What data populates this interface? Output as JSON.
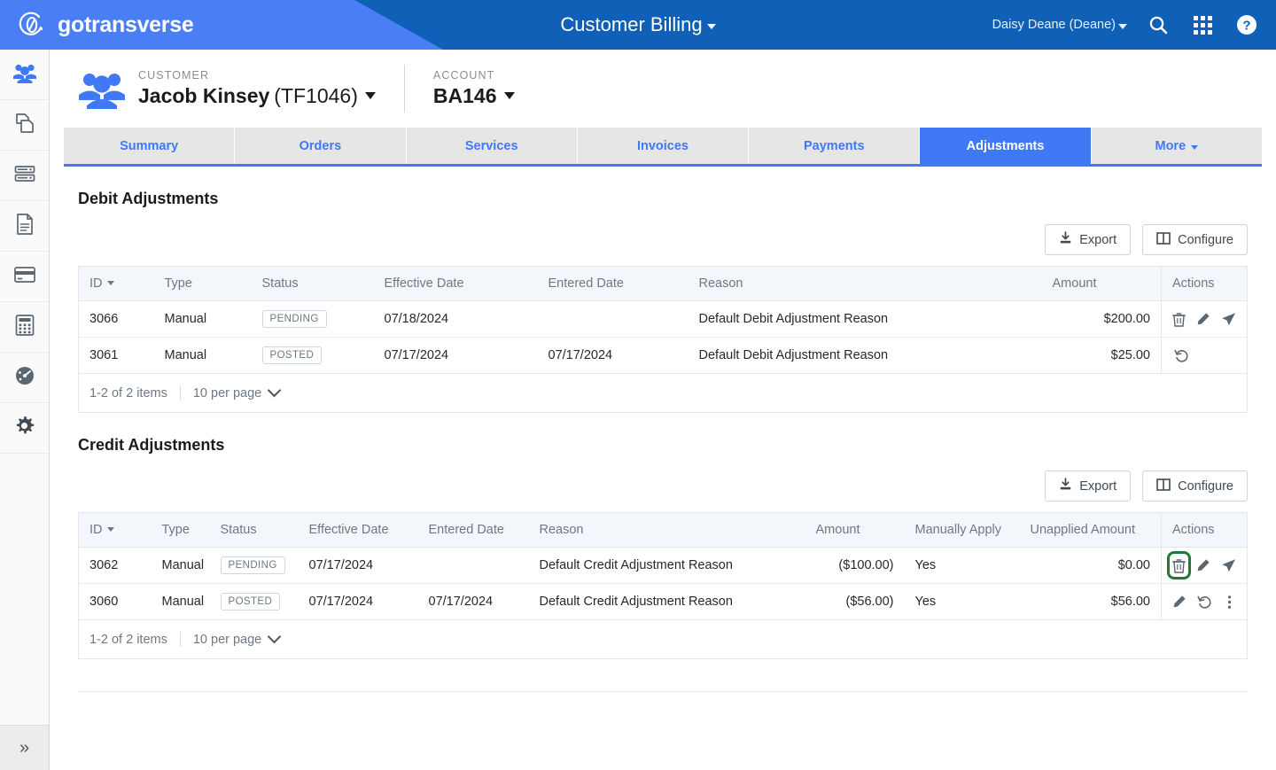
{
  "colors": {
    "brand_blue_light": "#4a7ef5",
    "brand_blue_dark": "#1060b8",
    "tab_active": "#4079f5",
    "highlight_green": "#1e7a36"
  },
  "topbar": {
    "brand_name": "gotransverse",
    "brand_logo_icon": "gotransverse-circle-logo-icon",
    "app_title": "Customer Billing",
    "app_title_caret_icon": "caret-down-icon",
    "user_name": "Daisy Deane (Deane)",
    "user_caret_icon": "caret-down-icon",
    "search_icon": "search-icon",
    "apps_icon": "apps-grid-icon",
    "help_icon": "help-circle-icon"
  },
  "rail": {
    "items": [
      {
        "icon": "customers-people-icon",
        "active": true
      },
      {
        "icon": "copy-documents-icon",
        "active": false
      },
      {
        "icon": "server-database-icon",
        "active": false
      },
      {
        "icon": "document-page-icon",
        "active": false
      },
      {
        "icon": "credit-card-icon",
        "active": false
      },
      {
        "icon": "calculator-icon",
        "active": false
      },
      {
        "icon": "dashboard-gauge-icon",
        "active": false
      },
      {
        "icon": "settings-gear-icon",
        "active": false
      }
    ],
    "expand_icon": "chevron-double-right-icon"
  },
  "context": {
    "customer_icon": "customer-people-icon",
    "customer_label": "CUSTOMER",
    "customer_name": "Jacob Kinsey",
    "customer_id": "(TF1046)",
    "account_label": "ACCOUNT",
    "account_value": "BA146"
  },
  "tabs": [
    {
      "label": "Summary",
      "active": false,
      "has_caret": false
    },
    {
      "label": "Orders",
      "active": false,
      "has_caret": false
    },
    {
      "label": "Services",
      "active": false,
      "has_caret": false
    },
    {
      "label": "Invoices",
      "active": false,
      "has_caret": false
    },
    {
      "label": "Payments",
      "active": false,
      "has_caret": false
    },
    {
      "label": "Adjustments",
      "active": true,
      "has_caret": false
    },
    {
      "label": "More",
      "active": false,
      "has_caret": true
    }
  ],
  "debit": {
    "title": "Debit Adjustments",
    "export_label": "Export",
    "export_icon": "download-icon",
    "configure_label": "Configure",
    "configure_icon": "columns-icon",
    "columns": [
      "ID",
      "Type",
      "Status",
      "Effective Date",
      "Entered Date",
      "Reason",
      "Amount",
      "Actions"
    ],
    "sorted_column": "ID",
    "rows": [
      {
        "id": "3066",
        "type": "Manual",
        "status": "PENDING",
        "effective_date": "07/18/2024",
        "entered_date": "",
        "reason": "Default Debit Adjustment Reason",
        "amount": "$200.00",
        "actions": [
          "delete-icon",
          "edit-icon",
          "send-icon"
        ]
      },
      {
        "id": "3061",
        "type": "Manual",
        "status": "POSTED",
        "effective_date": "07/17/2024",
        "entered_date": "07/17/2024",
        "reason": "Default Debit Adjustment Reason",
        "amount": "$25.00",
        "actions": [
          "revert-icon"
        ]
      }
    ],
    "pager": {
      "items_text": "1-2 of 2 items",
      "per_page_text": "10 per page"
    }
  },
  "credit": {
    "title": "Credit Adjustments",
    "export_label": "Export",
    "export_icon": "download-icon",
    "configure_label": "Configure",
    "configure_icon": "columns-icon",
    "columns": [
      "ID",
      "Type",
      "Status",
      "Effective Date",
      "Entered Date",
      "Reason",
      "Amount",
      "Manually Apply",
      "Unapplied Amount",
      "Actions"
    ],
    "sorted_column": "ID",
    "rows": [
      {
        "id": "3062",
        "type": "Manual",
        "status": "PENDING",
        "effective_date": "07/17/2024",
        "entered_date": "",
        "reason": "Default Credit Adjustment Reason",
        "amount": "($100.00)",
        "manually_apply": "Yes",
        "unapplied_amount": "$0.00",
        "actions": [
          "delete-icon",
          "edit-icon",
          "send-icon"
        ],
        "highlighted_action": "delete-icon"
      },
      {
        "id": "3060",
        "type": "Manual",
        "status": "POSTED",
        "effective_date": "07/17/2024",
        "entered_date": "07/17/2024",
        "reason": "Default Credit Adjustment Reason",
        "amount": "($56.00)",
        "manually_apply": "Yes",
        "unapplied_amount": "$56.00",
        "actions": [
          "edit-icon",
          "revert-icon",
          "more-vertical-icon"
        ],
        "highlighted_action": ""
      }
    ],
    "pager": {
      "items_text": "1-2 of 2 items",
      "per_page_text": "10 per page"
    }
  }
}
